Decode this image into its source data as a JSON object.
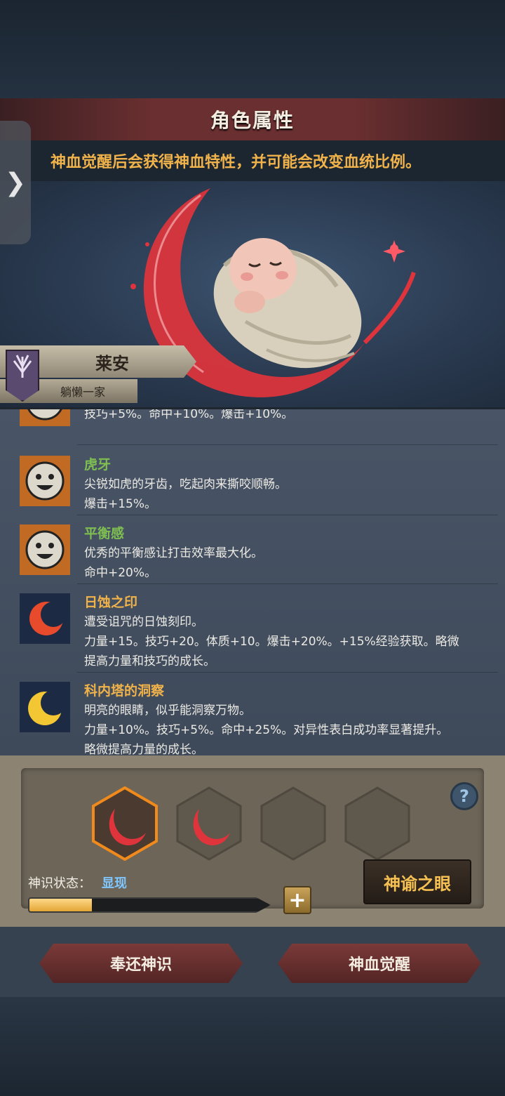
{
  "header": {
    "title": "角色属性",
    "hint": "神血觉醒后会获得神血特性，并可能会改变血统比例。"
  },
  "side_tab": {
    "icon": "chevron-right-icon",
    "glyph": "❯"
  },
  "character": {
    "name": "莱安",
    "family": "躺懒一家",
    "emblem_icon": "family-crest-icon"
  },
  "traits": [
    {
      "name": "",
      "lines": [
        "技巧+5%。命中+10%。爆击+10%。"
      ],
      "icon": "smiley-face-icon",
      "name_color": "#7fbf52"
    },
    {
      "name": "虎牙",
      "lines": [
        "尖锐如虎的牙齿，吃起肉来撕咬顺畅。",
        "爆击+15%。"
      ],
      "icon": "smiley-face-icon",
      "name_color": "#7fbf52"
    },
    {
      "name": "平衡感",
      "lines": [
        "优秀的平衡感让打击效率最大化。",
        "命中+20%。"
      ],
      "icon": "smiley-face-icon",
      "name_color": "#7fbf52"
    },
    {
      "name": "日蚀之印",
      "lines": [
        "遭受诅咒的日蚀刻印。",
        "力量+15。技巧+20。体质+10。爆击+20%。+15%经验获取。略微",
        "提高力量和技巧的成长。"
      ],
      "icon": "red-eclipse-icon",
      "name_color": "#f0b24a"
    },
    {
      "name": "科内塔的洞察",
      "lines": [
        "明亮的眼睛，似乎能洞察万物。",
        "力量+10%。技巧+5%。命中+25%。对异性表白成功率显著提升。",
        "略微提高力量的成长。"
      ],
      "icon": "golden-moon-icon",
      "name_color": "#f0b24a"
    }
  ],
  "divine_sense": {
    "status_label": "神识状态：",
    "status_value": "显现",
    "progress": 0.26,
    "slots": [
      {
        "state": "selected",
        "icon": "blood-crescent-icon"
      },
      {
        "state": "filled",
        "icon": "blood-crescent-icon"
      },
      {
        "state": "empty",
        "icon": ""
      },
      {
        "state": "empty",
        "icon": ""
      }
    ],
    "help_glyph": "?",
    "plus_glyph": "+",
    "oracle_button": "神谕之眼"
  },
  "actions": {
    "return_label": "奉还神识",
    "awaken_label": "神血觉醒"
  },
  "colors": {
    "accent_gold": "#f0b24a",
    "trait_green": "#7fbf52",
    "status_blue": "#7fc7ff",
    "blood_red": "#e0343c"
  }
}
